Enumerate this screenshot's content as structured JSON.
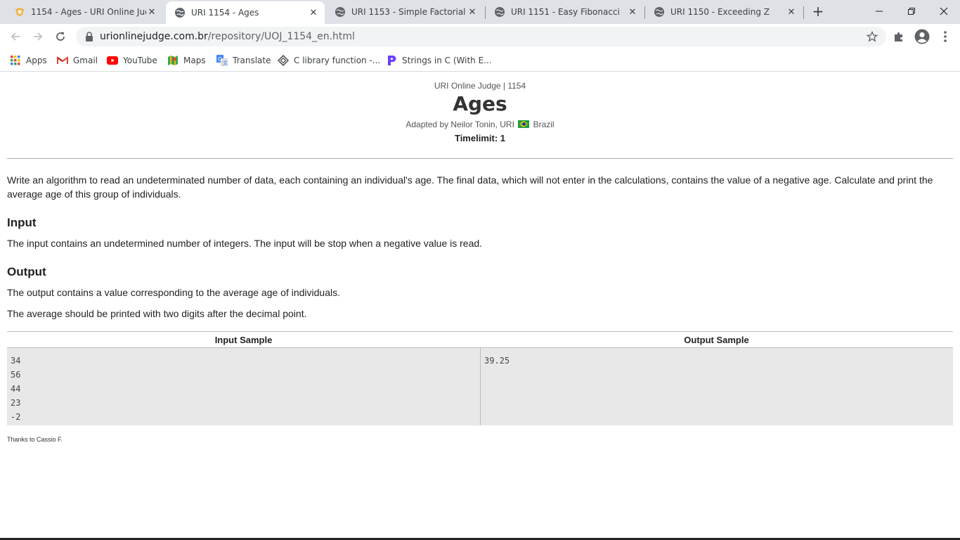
{
  "browser": {
    "tabs": [
      {
        "title": "1154 - Ages - URI Online Judge",
        "icon": "uri-favicon",
        "active": false
      },
      {
        "title": "URI 1154 - Ages",
        "icon": "globe-icon",
        "active": true
      },
      {
        "title": "URI 1153 - Simple Factorial",
        "icon": "globe-icon",
        "active": false
      },
      {
        "title": "URI 1151 - Easy Fibonacci",
        "icon": "globe-icon",
        "active": false
      },
      {
        "title": "URI 1150 - Exceeding Z",
        "icon": "globe-icon",
        "active": false
      }
    ],
    "new_tab_label": "+",
    "url_host": "urionlinejudge.com.br",
    "url_path": "/repository/UOJ_1154_en.html",
    "bookmarks": [
      {
        "label": "Apps",
        "icon": "apps-grid-icon"
      },
      {
        "label": "Gmail",
        "icon": "gmail-icon"
      },
      {
        "label": "YouTube",
        "icon": "youtube-icon"
      },
      {
        "label": "Maps",
        "icon": "maps-icon"
      },
      {
        "label": "Translate",
        "icon": "translate-icon"
      },
      {
        "label": "C library function -...",
        "icon": "c-library-icon"
      },
      {
        "label": "Strings in C (With E...",
        "icon": "programiz-icon"
      }
    ]
  },
  "page": {
    "subtitle": "URI Online Judge | 1154",
    "title": "Ages",
    "adapted_prefix": "Adapted by Neilor Tonin, URI",
    "adapted_country": "Brazil",
    "timelimit": "Timelimit: 1",
    "description": "Write an algorithm to read an undeterminated number of data, each containing an individual's age. The final data, which will not enter in the calculations, contains the value of a negative age. Calculate and print the average age of this group of individuals.",
    "input_heading": "Input",
    "input_text": "The input contains an undetermined number of integers. The input will be stop when a negative value is read.",
    "output_heading": "Output",
    "output_text_1": "The output contains a value corresponding to the average age of individuals.",
    "output_text_2": "The average should be printed with two digits after the decimal point.",
    "sample": {
      "input_header": "Input Sample",
      "output_header": "Output Sample",
      "input_value": "34\n56\n44\n23\n-2",
      "output_value": "39.25"
    },
    "thanks": "Thanks to Cassio F."
  }
}
